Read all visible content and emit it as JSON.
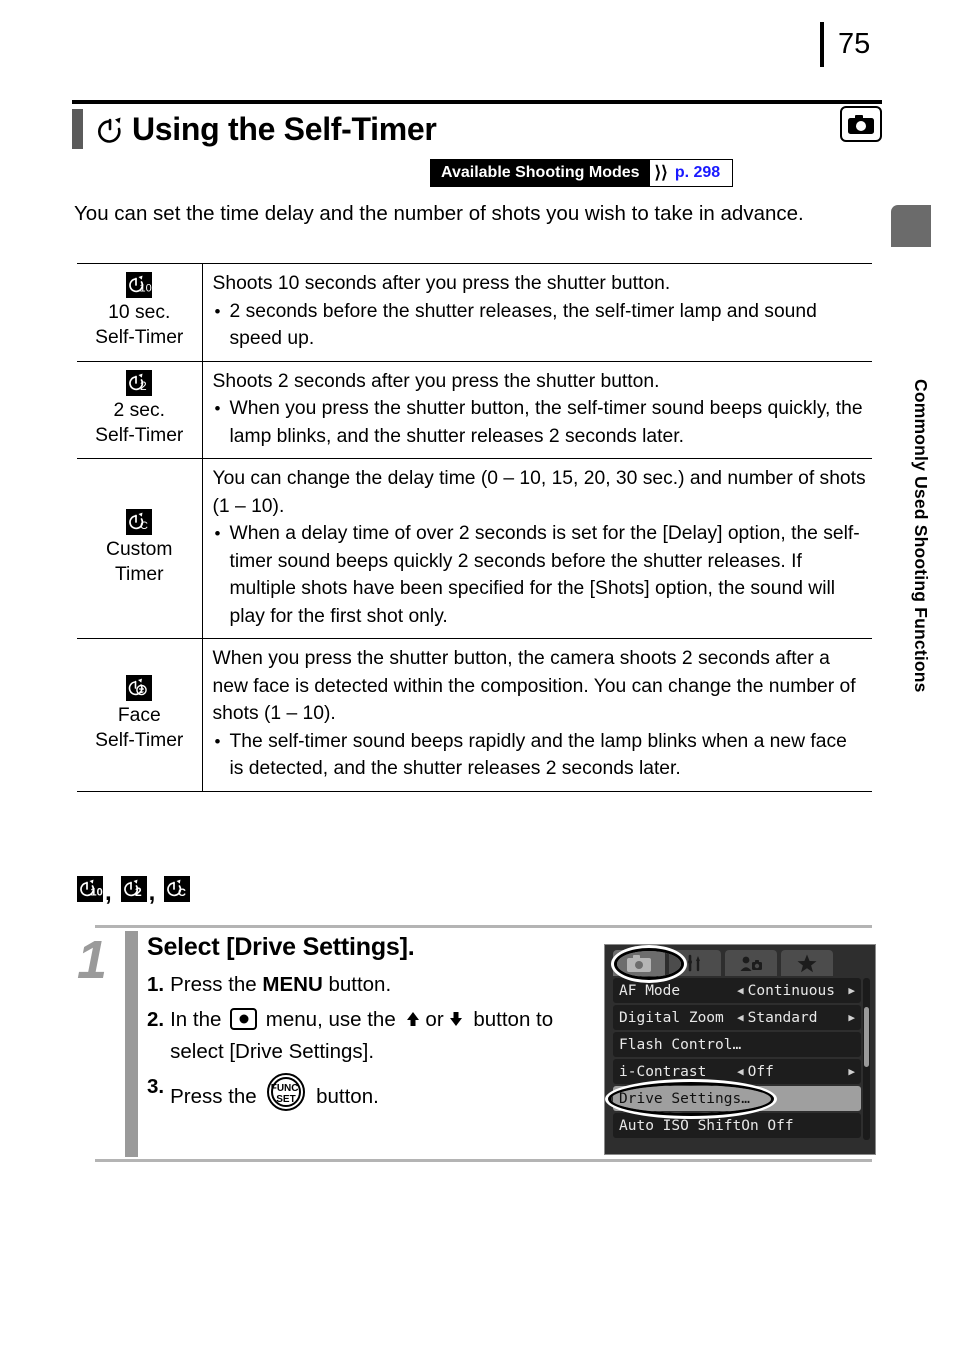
{
  "page": {
    "number": "75"
  },
  "side_tab": {
    "label": "Commonly Used Shooting Functions"
  },
  "header": {
    "title": "Using the Self-Timer",
    "timer_icon": "self-timer-icon",
    "camera_icon": "camera-icon",
    "badge": {
      "label": "Available Shooting Modes",
      "arrow": "⟩⟩",
      "page_ref": "p. 298"
    }
  },
  "intro": "You can set the time delay and the number of shots you wish to take in advance.",
  "table": {
    "rows": [
      {
        "icon": "self-timer-10sec-icon",
        "icon_text": "10",
        "mode_line1": "10 sec.",
        "mode_line2": "Self-Timer",
        "lead": "Shoots 10 seconds after you press the shutter button.",
        "bullets": [
          "2 seconds before the shutter releases, the self-timer lamp and sound speed up."
        ]
      },
      {
        "icon": "self-timer-2sec-icon",
        "icon_text": "2",
        "mode_line1": "2 sec.",
        "mode_line2": "Self-Timer",
        "lead": "Shoots 2 seconds after you press the shutter button.",
        "bullets": [
          "When you press the shutter button, the self-timer sound beeps quickly, the lamp blinks, and the shutter releases 2 seconds later."
        ]
      },
      {
        "icon": "self-timer-custom-icon",
        "icon_text": "C",
        "mode_line1": "Custom",
        "mode_line2": "Timer",
        "lead": "You can change the delay time (0 – 10, 15, 20, 30 sec.) and number of shots (1 – 10).",
        "bullets": [
          "When a delay time of over 2 seconds is set for the [Delay] option, the self-timer sound beeps quickly 2 seconds before the shutter releases. If multiple shots have been specified for the [Shots] option, the sound will play for the first shot only."
        ]
      },
      {
        "icon": "self-timer-face-icon",
        "icon_text": "face",
        "mode_line1": "Face",
        "mode_line2": "Self-Timer",
        "lead": "When you press the shutter button, the camera shoots 2 seconds after a new face is detected within the composition. You can change the number of shots (1 – 10).",
        "bullets": [
          "The self-timer sound beeps rapidly and the lamp blinks when a new face is detected, and the shutter releases 2 seconds later."
        ]
      }
    ]
  },
  "mode_icon_row": {
    "icons": [
      "self-timer-10sec-icon",
      "self-timer-2sec-icon",
      "self-timer-custom-icon"
    ],
    "icon_labels": [
      "10",
      "2",
      "C"
    ],
    "separator": ","
  },
  "step": {
    "number": "1",
    "title": "Select [Drive Settings].",
    "substeps": [
      {
        "n": "1.",
        "pre": "Press the ",
        "bold": "MENU",
        "post": " button."
      },
      {
        "n": "2.",
        "pre": "In the ",
        "mid": " menu, use the ",
        "post": " button to select [Drive Settings].",
        "or_text": "or"
      },
      {
        "n": "3.",
        "pre": "Press the ",
        "post": " button."
      }
    ],
    "funcset_top": "FUNC.",
    "funcset_bottom": "SET"
  },
  "lcd": {
    "tabs": [
      {
        "name": "shooting-tab",
        "icon": "camera-icon",
        "selected": true
      },
      {
        "name": "setup-tab",
        "icon": "wrench-icon",
        "selected": false
      },
      {
        "name": "my-camera-tab",
        "icon": "my-camera-icon",
        "selected": false
      },
      {
        "name": "favorites-tab",
        "icon": "star-icon",
        "selected": false
      }
    ],
    "items": [
      {
        "name": "AF Mode",
        "value": "Continuous",
        "chevrons": true,
        "highlighted": false
      },
      {
        "name": "Digital Zoom",
        "value": "Standard",
        "chevrons": true,
        "highlighted": false
      },
      {
        "name": "Flash Control…",
        "value": "",
        "chevrons": false,
        "highlighted": false
      },
      {
        "name": "i-Contrast",
        "value": "Off",
        "chevrons": true,
        "highlighted": false
      },
      {
        "name": "Drive Settings…",
        "value": "",
        "chevrons": false,
        "highlighted": true
      },
      {
        "name": "Auto ISO Shift",
        "value": "On Off",
        "chevrons": false,
        "highlighted": false
      }
    ]
  },
  "colors": {
    "accent_blue": "#1a1aff",
    "side_tab_gray": "#6b6b6b",
    "step_gray": "#9a9a9a",
    "rule_gray": "#b4b4b4",
    "lcd_bg": "#2e2e2e"
  }
}
